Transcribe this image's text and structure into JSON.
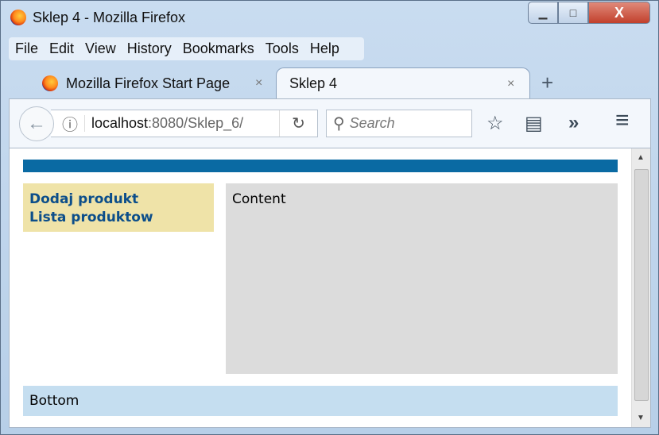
{
  "window": {
    "title": "Sklep 4 - Mozilla Firefox",
    "minimize": "▁",
    "maximize": "□",
    "close": "X"
  },
  "menubar": [
    "File",
    "Edit",
    "View",
    "History",
    "Bookmarks",
    "Tools",
    "Help"
  ],
  "tabs": [
    {
      "label": "Mozilla Firefox Start Page",
      "active": false
    },
    {
      "label": "Sklep 4",
      "active": true
    }
  ],
  "tab_close": "×",
  "new_tab": "+",
  "navbar": {
    "back": "←",
    "info": "ⓘ",
    "url_host": "localhost",
    "url_rest": ":8080/Sklep_6/",
    "reload": "↻",
    "search_icon": "⚲",
    "search_placeholder": "Search",
    "bookmark": "☆",
    "reading_list": "▤",
    "overflow": "»",
    "hamburger": "≡"
  },
  "page": {
    "menu": [
      "Dodaj produkt",
      "Lista produktow"
    ],
    "content": "Content",
    "bottom": "Bottom",
    "accent": "#0a6aa3"
  },
  "scrollbar": {
    "up": "▲",
    "down": "▼"
  }
}
